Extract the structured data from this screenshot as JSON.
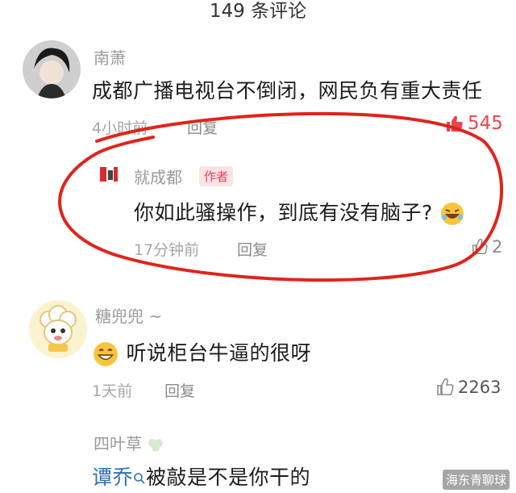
{
  "header": {
    "title": "149 条评论"
  },
  "comments": [
    {
      "username": "南萧",
      "text": "成都广播电视台不倒闭，网民负有重大责任",
      "time": "4小时前",
      "reply": "回复",
      "likes": "545",
      "avatar": "dark-haired-person-avatar"
    },
    {
      "username": "就成都",
      "badge": "作者",
      "text": "你如此骚操作，到底有没有脑子?",
      "time": "17分钟前",
      "reply": "回复",
      "likes": "2",
      "avatar": "red-logo-avatar"
    },
    {
      "username": "糖兜兜 ~",
      "text": "听说柜台牛逼的很呀",
      "time": "1天前",
      "reply": "回复",
      "likes": "2263",
      "avatar": "cartoon-sheep-avatar"
    },
    {
      "username": "四叶草",
      "text_prefix": "谭乔",
      "text": "被敲是不是你干的"
    }
  ],
  "watermark": "海东青聊球",
  "colors": {
    "accent": "#e5405e",
    "circle": "#e0241b",
    "like_red": "#e8464e"
  }
}
